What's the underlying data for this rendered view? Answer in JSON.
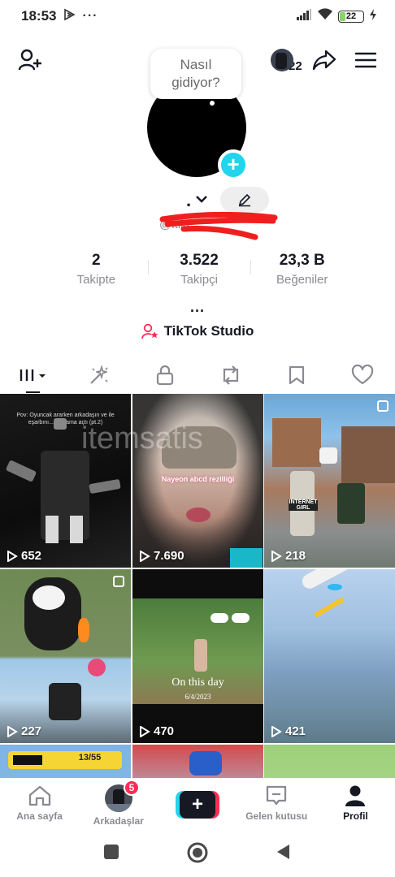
{
  "status_bar": {
    "time": "18:53",
    "battery": "22"
  },
  "header": {
    "friends_count": "22"
  },
  "profile": {
    "bubble_text": "Nasıl gidiyor?",
    "name": ".",
    "username": "@kiki..."
  },
  "stats": [
    {
      "value": "2",
      "label": "Takipte"
    },
    {
      "value": "3.522",
      "label": "Takipçi"
    },
    {
      "value": "23,3 B",
      "label": "Beğeniler"
    }
  ],
  "more_dots": "...",
  "studio_label": "TikTok Studio",
  "tabs": [
    "videos-tab",
    "reposts-effects-tab",
    "private-tab",
    "reposts-tab",
    "favorites-tab",
    "liked-tab"
  ],
  "videos": [
    {
      "views": "652",
      "caption": "Pov: Oyuncak ararken arkadaşın ve ile eşarbını... bağlama açtı (pt.2)"
    },
    {
      "views": "7.690",
      "caption": "Nayeon abcd rezilliği",
      "watermark": "itemsatis"
    },
    {
      "views": "218",
      "caption": "INTERNET GIRL"
    },
    {
      "views": "227",
      "caption": ""
    },
    {
      "views": "470",
      "caption": "On this day",
      "date": "6/4/2023"
    },
    {
      "views": "421",
      "caption": ""
    },
    {
      "views": "",
      "caption": "13/55"
    },
    {
      "views": "",
      "caption": ""
    },
    {
      "views": "",
      "caption": ""
    }
  ],
  "bottom_nav": {
    "home": "Ana sayfa",
    "friends": "Arkadaşlar",
    "friends_badge": "5",
    "inbox": "Gelen kutusu",
    "profile": "Profil"
  },
  "colors": {
    "accent_red": "#fe2c55",
    "accent_cyan": "#20d5ec",
    "text": "#161823",
    "muted": "#8a8b91"
  }
}
